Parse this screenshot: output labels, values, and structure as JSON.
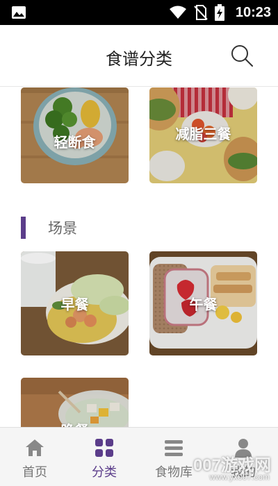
{
  "status_bar": {
    "time": "10:23",
    "icons": [
      "image-icon",
      "wifi-icon",
      "no-sim-icon",
      "battery-charging-icon"
    ]
  },
  "header": {
    "title": "食谱分类",
    "search_icon": "search-icon"
  },
  "categories": [
    {
      "label": "轻断食"
    },
    {
      "label": "减脂三餐"
    }
  ],
  "scene_section": {
    "title": "场景",
    "items": [
      {
        "label": "早餐"
      },
      {
        "label": "午餐"
      },
      {
        "label": "晚餐"
      }
    ]
  },
  "bottom_nav": {
    "items": [
      {
        "label": "首页",
        "icon": "home-icon",
        "active": false
      },
      {
        "label": "分类",
        "icon": "grid-icon",
        "active": true
      },
      {
        "label": "食物库",
        "icon": "list-icon",
        "active": false
      },
      {
        "label": "我的",
        "icon": "person-icon",
        "active": false
      }
    ]
  },
  "colors": {
    "accent": "#5b3d8a",
    "nav_inactive": "#777777"
  },
  "watermark": {
    "text": "007游戏网",
    "url_text": "www.yx007.com"
  }
}
